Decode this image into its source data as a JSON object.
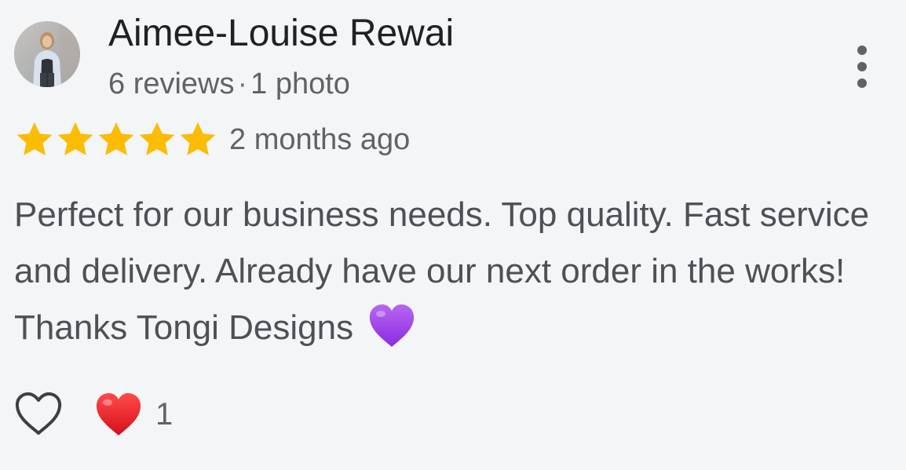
{
  "reviewer": {
    "name": "Aimee-Louise Rewai",
    "reviews_count": "6 reviews",
    "separator": "·",
    "photos_count": "1 photo"
  },
  "review": {
    "rating": 5,
    "max_rating": 5,
    "date": "2 months ago",
    "text": "Perfect for our business needs. Top quality. Fast service and delivery. Already have our next order in the works! Thanks Tongi Designs",
    "star_color": "#fbbc04",
    "trailing_emoji": "purple-heart-icon"
  },
  "actions": {
    "like_icon": "heart-outline-icon",
    "reaction_icon": "red-heart-icon",
    "reaction_count": "1"
  },
  "icons": {
    "more": "more-vertical-icon"
  }
}
